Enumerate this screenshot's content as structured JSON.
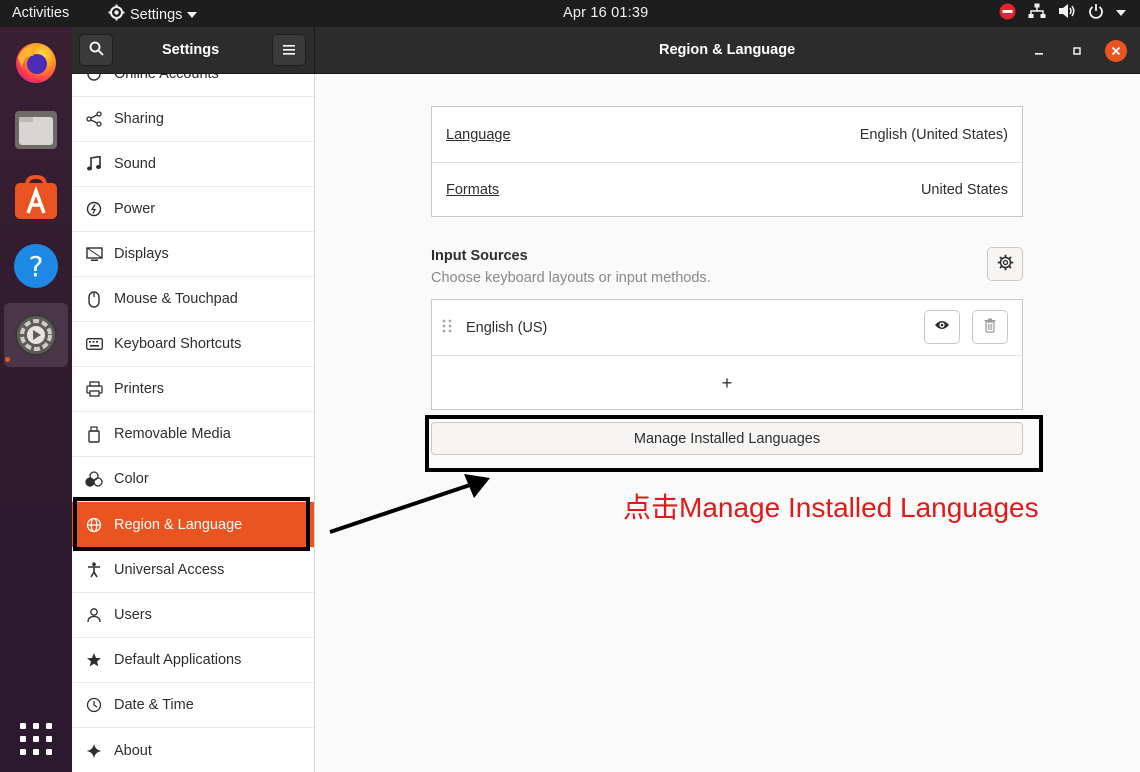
{
  "topbar": {
    "activities": "Activities",
    "app_menu": "Settings",
    "clock": "Apr 16  01:39"
  },
  "dock": {
    "items": [
      "firefox-icon",
      "files-icon",
      "software-icon",
      "help-icon",
      "settings-icon"
    ],
    "show_apps": "show-apps-icon"
  },
  "header": {
    "sidebar_title": "Settings",
    "title": "Region & Language"
  },
  "sidebar": {
    "items": [
      {
        "label": "Online Accounts",
        "icon": "online-accounts-icon"
      },
      {
        "label": "Sharing",
        "icon": "share-icon"
      },
      {
        "label": "Sound",
        "icon": "music-note-icon"
      },
      {
        "label": "Power",
        "icon": "power-icon"
      },
      {
        "label": "Displays",
        "icon": "display-icon"
      },
      {
        "label": "Mouse & Touchpad",
        "icon": "mouse-icon"
      },
      {
        "label": "Keyboard Shortcuts",
        "icon": "keyboard-icon"
      },
      {
        "label": "Printers",
        "icon": "printer-icon"
      },
      {
        "label": "Removable Media",
        "icon": "removable-media-icon"
      },
      {
        "label": "Color",
        "icon": "color-icon"
      },
      {
        "label": "Region & Language",
        "icon": "globe-icon",
        "selected": true
      },
      {
        "label": "Universal Access",
        "icon": "accessibility-icon"
      },
      {
        "label": "Users",
        "icon": "users-icon"
      },
      {
        "label": "Default Applications",
        "icon": "star-icon"
      },
      {
        "label": "Date & Time",
        "icon": "clock-icon"
      },
      {
        "label": "About",
        "icon": "sparkle-icon"
      }
    ]
  },
  "region": {
    "language_label": "Language",
    "language_value": "English (United States)",
    "formats_label": "Formats",
    "formats_value": "United States"
  },
  "input_sources": {
    "title": "Input Sources",
    "subtitle": "Choose keyboard layouts or input methods.",
    "items": [
      {
        "label": "English (US)"
      }
    ],
    "add_symbol": "+"
  },
  "manage_button": "Manage Installed Languages",
  "annotation": {
    "text": "点击Manage Installed Languages",
    "color": "#e0191a"
  },
  "colors": {
    "accent": "#e95420",
    "topbar": "#1d1d1d",
    "headerbar": "#2c2c2c"
  }
}
